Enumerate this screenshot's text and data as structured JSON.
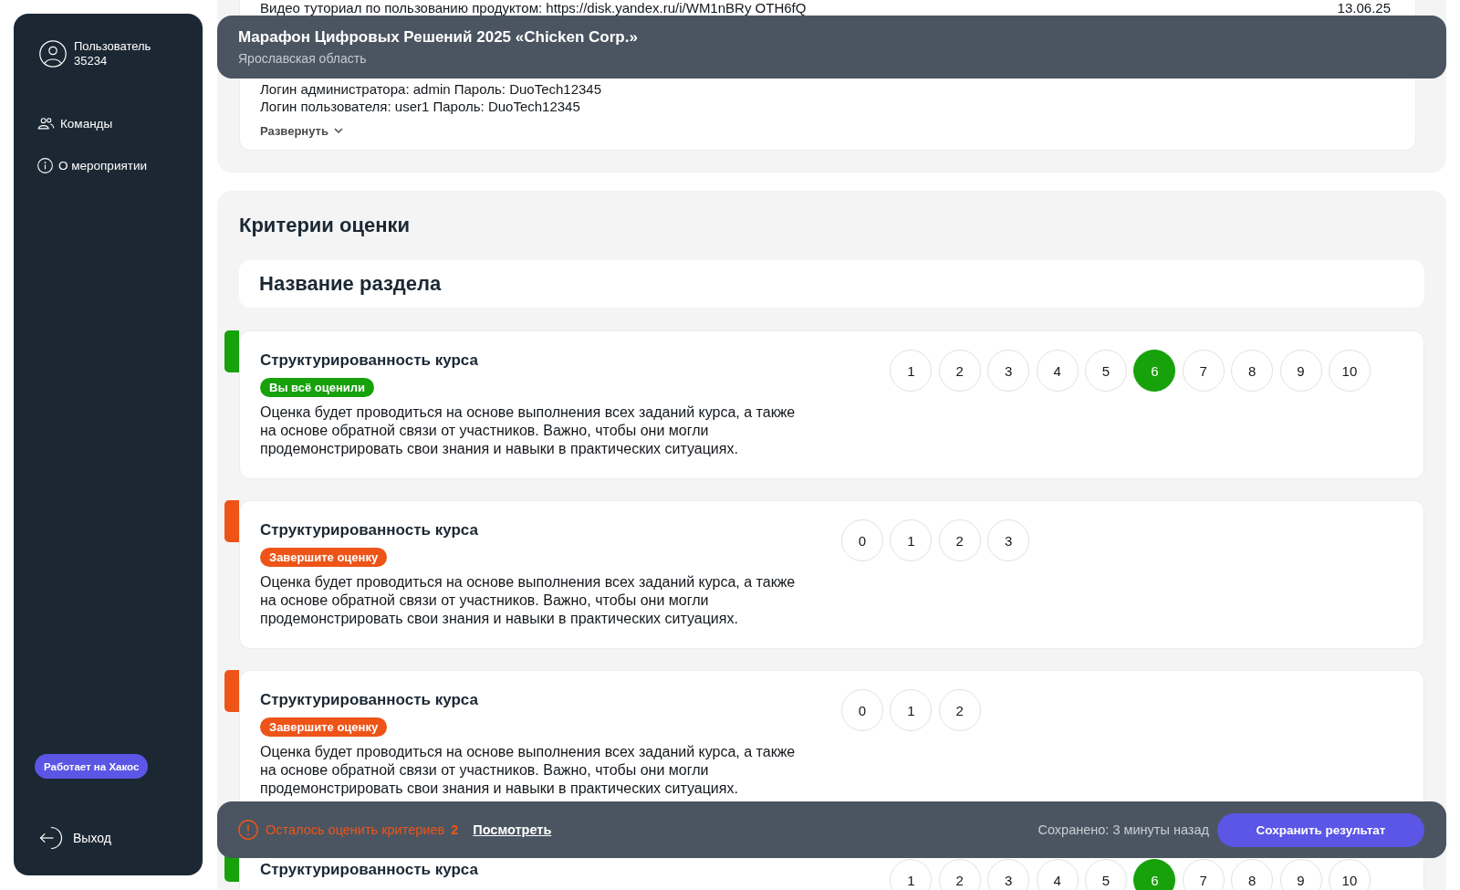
{
  "sidebar": {
    "user_name": "Пользователь",
    "user_number": "35234",
    "nav": [
      {
        "label": "Команды",
        "selected": false
      },
      {
        "label": "О мероприятии",
        "selected": false
      }
    ],
    "powered_badge": "Работает на Хакос",
    "logout": "Выход"
  },
  "event_info": {
    "tutorial_line": "Видео туториал по пользованию продуктом: https://disk.yandex.ru/i/WM1nBRy OTH6fQ",
    "date": "13.06.25",
    "credentials": [
      "Логин администратора: admin Пароль: DuoTech12345",
      "Логин пользователя: user1 Пароль: DuoTech12345"
    ],
    "expand_label": "Развернуть"
  },
  "header": {
    "title": "Марафон Цифровых Решений 2025 «Chicken Corp.»",
    "region": "Ярославская область"
  },
  "criteria": {
    "heading": "Критерии оценки",
    "section_title": "Название раздела",
    "items": [
      {
        "title": "Структурированность курса",
        "completed": true,
        "badge": "Вы всё оценили",
        "description": "Оценка будет проводиться на основе выполнения всех заданий курса, а также на основе обратной связи от участников. Важно, чтобы они могли продемонстрировать свои знания и навыки в практических ситуациях.",
        "scores": [
          {
            "label": "1",
            "selected": false
          },
          {
            "label": "2",
            "selected": false
          },
          {
            "label": "3",
            "selected": false
          },
          {
            "label": "4",
            "selected": false
          },
          {
            "label": "5",
            "selected": false
          },
          {
            "label": "6",
            "selected": true
          },
          {
            "label": "7",
            "selected": false
          },
          {
            "label": "8",
            "selected": false
          },
          {
            "label": "9",
            "selected": false
          },
          {
            "label": "10",
            "selected": false
          }
        ]
      },
      {
        "title": "Структурированность курса",
        "completed": false,
        "badge": "Завершите оценку",
        "description": "Оценка будет проводиться на основе выполнения всех заданий курса, а также на основе обратной связи от участников. Важно, чтобы они могли продемонстрировать свои знания и навыки в практических ситуациях.",
        "scores": [
          {
            "label": "0",
            "selected": false
          },
          {
            "label": "1",
            "selected": false
          },
          {
            "label": "2",
            "selected": false
          },
          {
            "label": "3",
            "selected": false
          }
        ]
      },
      {
        "title": "Структурированность курса",
        "completed": false,
        "badge": "Завершите оценку",
        "description": "Оценка будет проводиться на основе выполнения всех заданий курса, а также на основе обратной связи от участников. Важно, чтобы они могли продемонстрировать свои знания и навыки в практических ситуациях.",
        "scores": [
          {
            "label": "0",
            "selected": false
          },
          {
            "label": "1",
            "selected": false
          },
          {
            "label": "2",
            "selected": false
          }
        ]
      },
      {
        "title": "Структурированность курса",
        "completed": true,
        "scores": [
          {
            "label": "1",
            "selected": false
          },
          {
            "label": "2",
            "selected": false
          },
          {
            "label": "3",
            "selected": false
          },
          {
            "label": "4",
            "selected": false
          },
          {
            "label": "5",
            "selected": false
          },
          {
            "label": "6",
            "selected": true
          },
          {
            "label": "7",
            "selected": false
          },
          {
            "label": "8",
            "selected": false
          },
          {
            "label": "9",
            "selected": false
          },
          {
            "label": "10",
            "selected": false
          }
        ]
      }
    ]
  },
  "footer": {
    "remaining_label": "Осталось оценить критериев",
    "remaining_count": "2",
    "view_link": "Посмотреть",
    "saved_status": "Сохранено: 3 минуты назад",
    "save_button": "Сохранить результат"
  }
}
